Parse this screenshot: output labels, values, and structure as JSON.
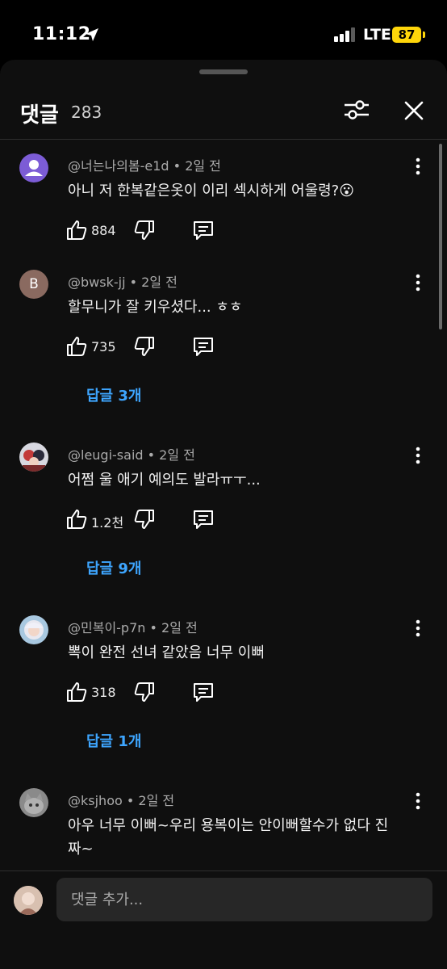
{
  "status_bar": {
    "time": "11:12",
    "network": "LTE",
    "battery": "87"
  },
  "header": {
    "title": "댓글",
    "count": "283"
  },
  "comments": [
    {
      "author": "@너는나의봄-e1d",
      "age": "2일 전",
      "text": "아니 저 한복같은옷이 이리 섹시하게 어울령?😮",
      "likes": "884",
      "replies": ""
    },
    {
      "author": "@bwsk-jj",
      "age": "2일 전",
      "text": "할무니가 잘 키우셨다... ㅎㅎ",
      "likes": "735",
      "replies": "답글 3개",
      "avatar_letter": "B"
    },
    {
      "author": "@leugi-said",
      "age": "2일 전",
      "text": "어쩜 울 애기 예의도 발라ㅠㅜ...",
      "likes": "1.2천",
      "replies": "답글 9개"
    },
    {
      "author": "@민복이-p7n",
      "age": "2일 전",
      "text": "뽁이 완전 선녀 같았음 너무 이뻐",
      "likes": "318",
      "replies": "답글 1개"
    },
    {
      "author": "@ksjhoo",
      "age": "2일 전",
      "text": "아우 너무 이뻐~우리 용복이는 안이뻐할수가 없다 진짜~",
      "likes": "",
      "replies": ""
    }
  ],
  "meta_separator": "•",
  "input": {
    "placeholder": "댓글 추가..."
  },
  "icons": {
    "location": "location-arrow-icon",
    "signal": "cellular-signal-icon",
    "filter": "filter-sliders-icon",
    "close": "close-icon",
    "more": "more-vertical-icon",
    "like": "thumbs-up-icon",
    "dislike": "thumbs-down-icon",
    "reply": "comment-reply-icon"
  },
  "colors": {
    "background": "#0f0f0f",
    "link": "#3ea6ff",
    "battery": "#ffd60a",
    "avatar_purple": "#7c5cd6",
    "avatar_brown": "#8a6a60"
  }
}
